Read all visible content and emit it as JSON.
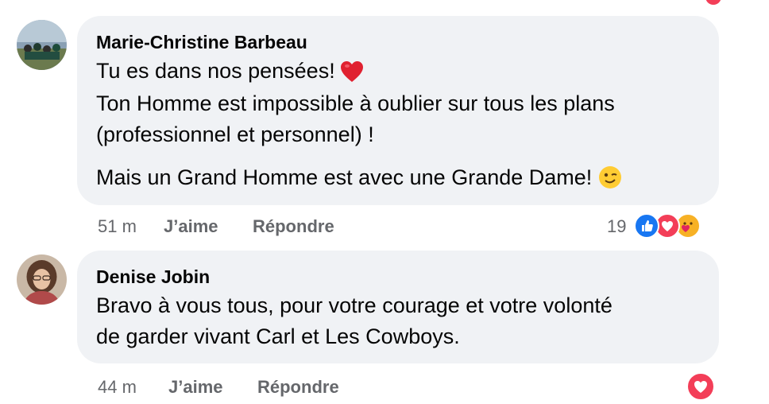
{
  "comments": [
    {
      "author": "Marie-Christine Barbeau",
      "lines": [
        "Tu es dans nos pensées!",
        "Ton Homme est impossible à oublier sur tous les plans",
        "(professionnel et personnel) !",
        "Mais un Grand Homme est avec une Grande Dame!"
      ],
      "time": "51 m",
      "like_label": "J’aime",
      "reply_label": "Répondre",
      "reaction_count": "19",
      "reactions": [
        "like-icon",
        "love-icon",
        "care-icon"
      ]
    },
    {
      "author": "Denise Jobin",
      "lines": [
        "Bravo à vous tous, pour votre courage et votre volonté",
        "de garder vivant Carl et Les Cowboys."
      ],
      "time": "44 m",
      "like_label": "J’aime",
      "reply_label": "Répondre",
      "reactions": [
        "love-icon"
      ]
    }
  ],
  "colors": {
    "bubble": "#f0f2f5",
    "meta_text": "#65676b",
    "like_blue": "#1877f2",
    "love_red": "#f33e58"
  }
}
